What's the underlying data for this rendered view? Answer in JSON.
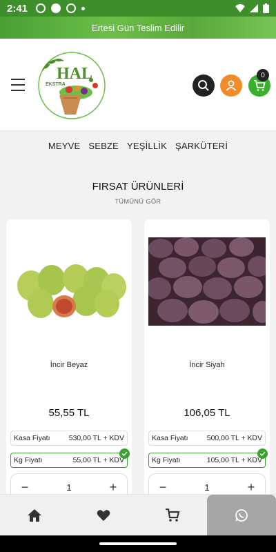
{
  "status_bar": {
    "time": "2:41"
  },
  "banner": {
    "text": "Ertesi Gün Teslim Edilir"
  },
  "header": {
    "logo_text_big": "HAL",
    "logo_text_small": "EKSTRA",
    "cart_count": "0"
  },
  "nav": {
    "items": [
      "MEYVE",
      "SEBZE",
      "YEŞİLLİK",
      "ŞARKÜTERİ"
    ]
  },
  "section": {
    "title": "FIRSAT ÜRÜNLERİ",
    "see_all": "TÜMÜNÜ GÖR"
  },
  "products": [
    {
      "name": "İncir Beyaz",
      "price": "55,55 TL",
      "kasa_label": "Kasa Fiyatı",
      "kasa_value": "530,00 TL + KDV",
      "kg_label": "Kg Fiyatı",
      "kg_value": "55,00 TL + KDV",
      "quantity": "1",
      "minus": "−",
      "plus": "+"
    },
    {
      "name": "İncir Siyah",
      "price": "106,05 TL",
      "kasa_label": "Kasa Fiyatı",
      "kasa_value": "500,00 TL + KDV",
      "kg_label": "Kg Fiyatı",
      "kg_value": "105,00 TL + KDV",
      "quantity": "1",
      "minus": "−",
      "plus": "+"
    }
  ],
  "colors": {
    "brand_green": "#38b02b",
    "accent_orange": "#f28c28",
    "dark": "#222222"
  },
  "icons": {
    "bottom_nav": [
      "home-icon",
      "heart-icon",
      "cart-icon",
      "whatsapp-icon"
    ]
  }
}
